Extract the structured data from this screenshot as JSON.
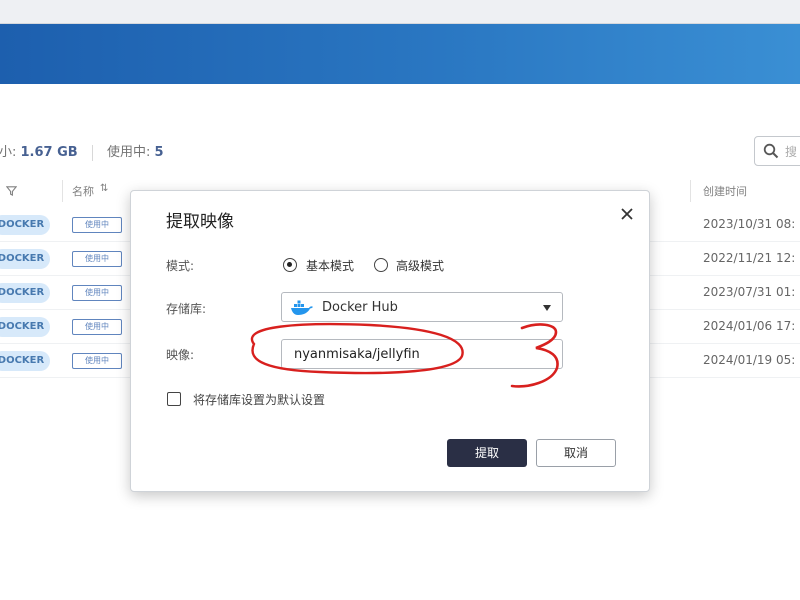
{
  "stats": {
    "size_label": "大小: ",
    "size_value": "1.67 GB",
    "inuse_label": "使用中: ",
    "inuse_value": "5"
  },
  "search": {
    "placeholder": "搜"
  },
  "table": {
    "columns": {
      "name": "名称",
      "created": "创建时间"
    },
    "rows": [
      {
        "type_badge": "DOCKER",
        "status": "使用中",
        "created": "2023/10/31 08:"
      },
      {
        "type_badge": "DOCKER",
        "status": "使用中",
        "created": "2022/11/21 12:"
      },
      {
        "type_badge": "DOCKER",
        "status": "使用中",
        "created": "2023/07/31 01:"
      },
      {
        "type_badge": "DOCKER",
        "status": "使用中",
        "created": "2024/01/06 17:"
      },
      {
        "type_badge": "DOCKER",
        "status": "使用中",
        "created": "2024/01/19 05:"
      }
    ]
  },
  "dialog": {
    "title": "提取映像",
    "mode_label": "模式:",
    "mode_options": [
      "基本模式",
      "高级模式"
    ],
    "mode_selected": "基本模式",
    "registry_label": "存储库:",
    "registry_value": "Docker Hub",
    "image_label": "映像:",
    "image_value": "nyanmisaka/jellyfin",
    "default_checkbox_label": "将存储库设置为默认设置",
    "default_checked": false,
    "pull_button": "提取",
    "cancel_button": "取消"
  },
  "annotation": {
    "color": "#d8201e",
    "number": "3"
  },
  "icons": {
    "search": "search-icon",
    "filter": "filter-icon",
    "sort": "sort-icon",
    "close": "close-icon",
    "docker": "docker-whale-icon",
    "dropdown": "chevron-down-icon"
  },
  "colors": {
    "banner": "#2a77c2",
    "primary_button": "#2a2f45",
    "badge_bg": "#cfe5f9",
    "badge_text": "#1f5c9e",
    "inuse_border": "#3e6bb0"
  }
}
